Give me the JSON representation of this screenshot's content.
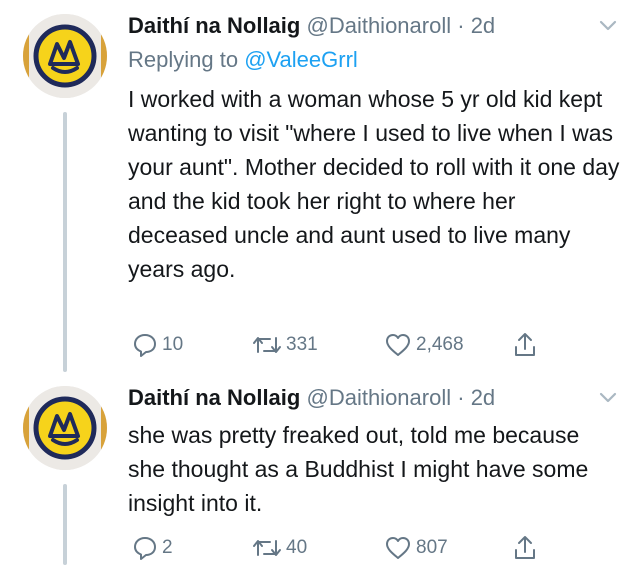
{
  "tweets": [
    {
      "display_name": "Daithí na Nollaig",
      "handle": "@Daithionaroll",
      "separator": "·",
      "time": "2d",
      "replying_prefix": "Replying to ",
      "replying_to": "@ValeeGrrl",
      "text": "I worked with a woman whose 5 yr old kid kept wanting to visit \"where I used to live when I was your aunt\". Mother decided to roll with it one day and the kid took her right to where her deceased uncle and aunt used to live many years ago.",
      "replies": "10",
      "retweets": "331",
      "likes": "2,468"
    },
    {
      "display_name": "Daithí na Nollaig",
      "handle": "@Daithionaroll",
      "separator": "·",
      "time": "2d",
      "text": "she was pretty freaked out, told me because she thought as a Buddhist I might have some insight into it.",
      "replies": "2",
      "retweets": "40",
      "likes": "807"
    }
  ],
  "icons": {
    "reply": "speech-bubble-icon",
    "retweet": "retweet-arrows-icon",
    "like": "heart-icon",
    "share": "share-up-arrow-icon",
    "menu": "chevron-down-icon"
  },
  "colors": {
    "text": "#14171a",
    "muted": "#657786",
    "link": "#1da1f2",
    "thread_line": "#c7d1d8",
    "avatar_yellow": "#f6d31b",
    "avatar_navy": "#1f2a5a"
  }
}
